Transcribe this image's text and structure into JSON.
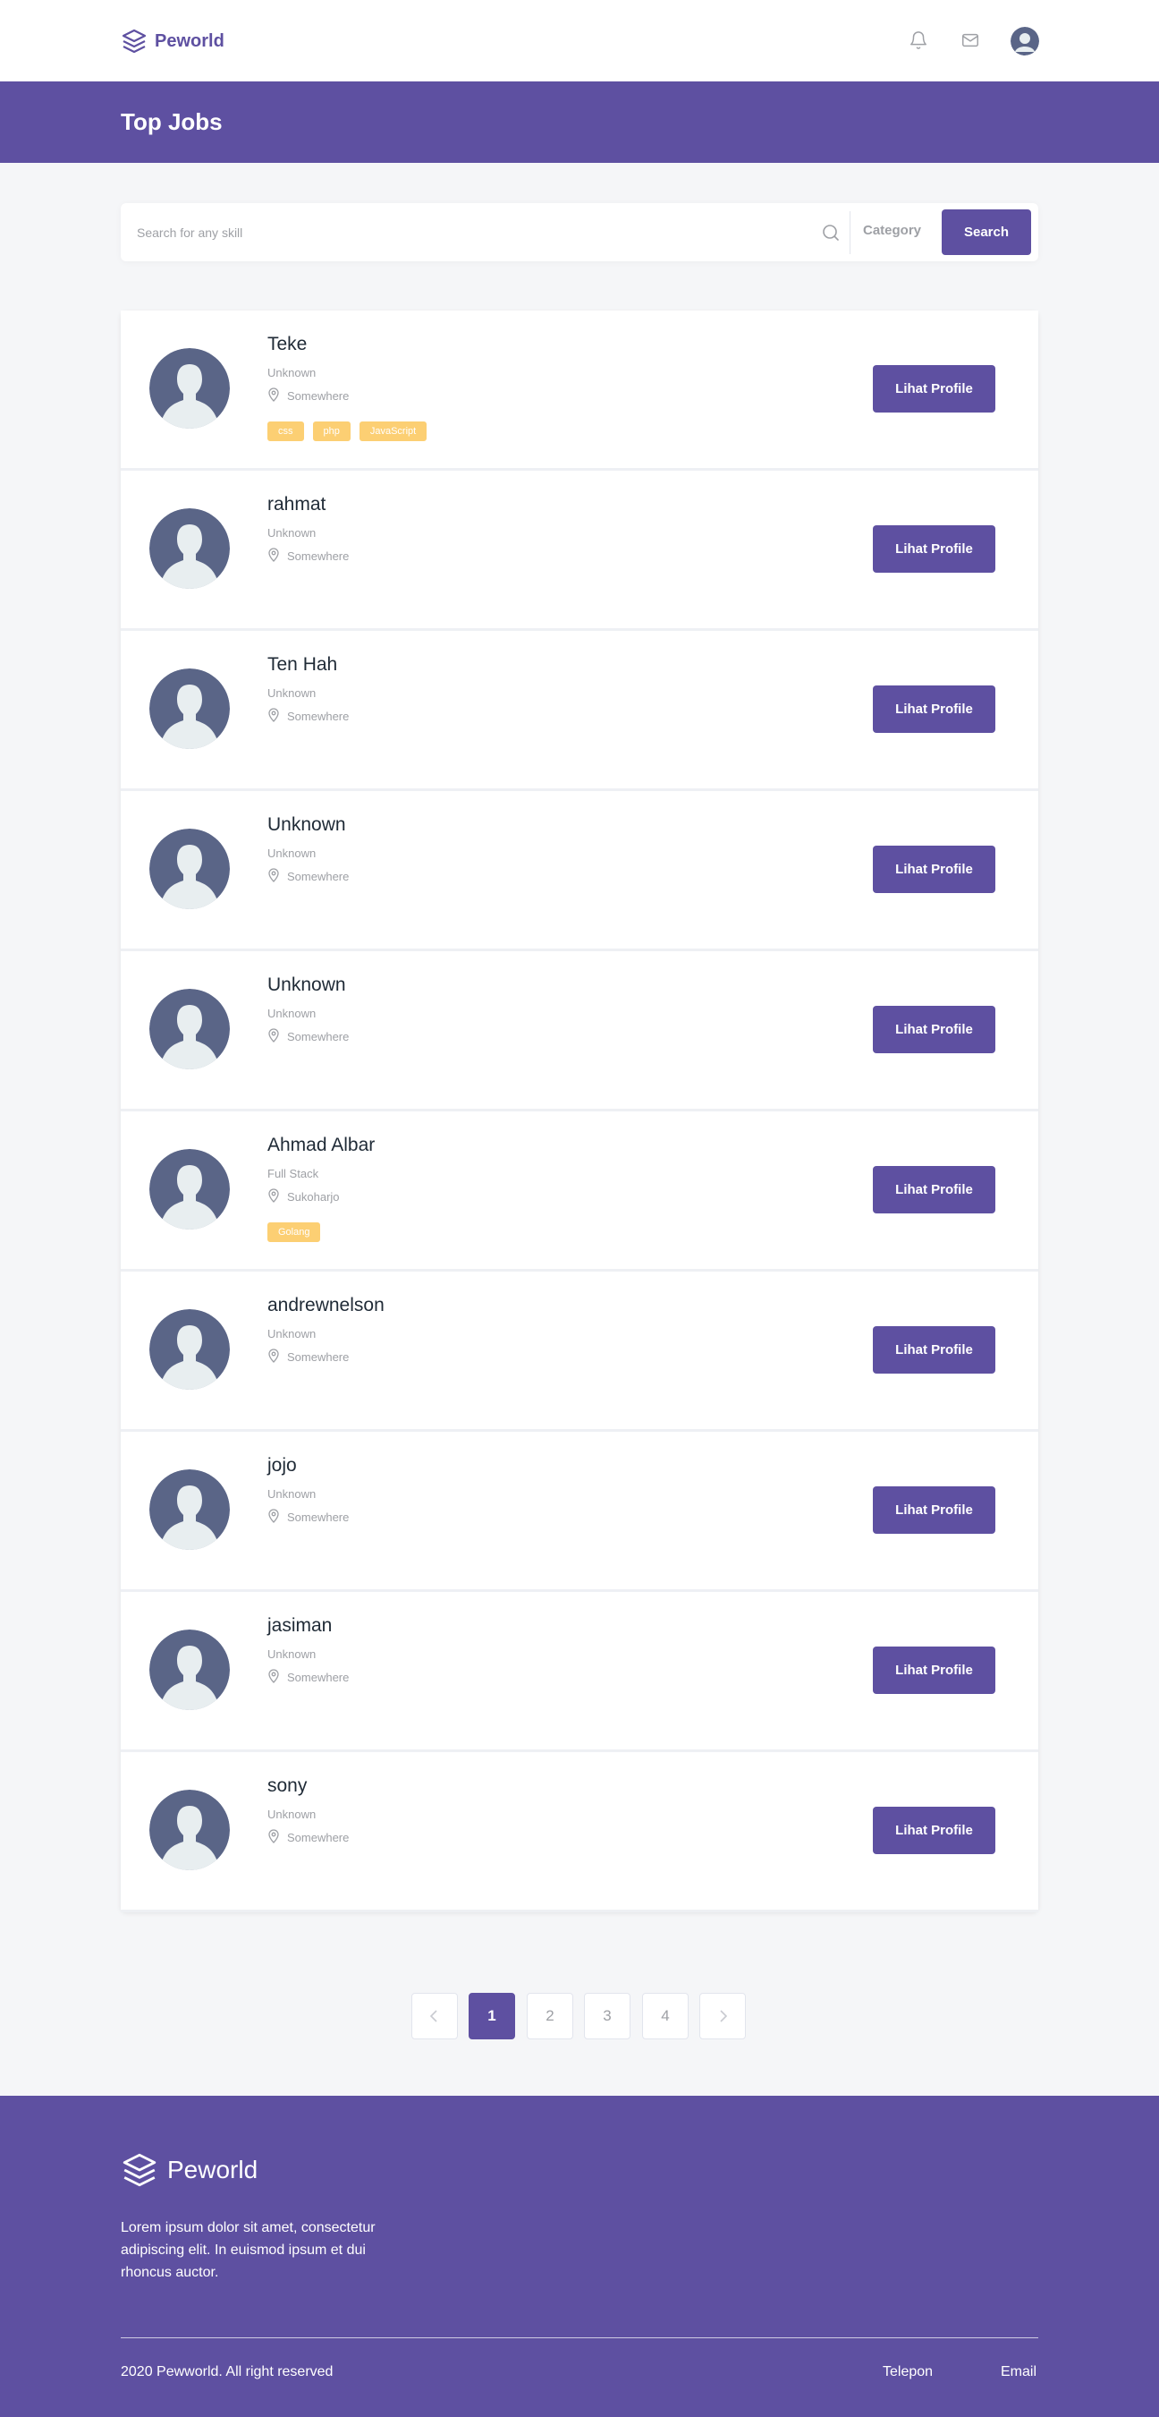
{
  "navbar": {
    "brand": "Peworld",
    "icons": [
      "bell-icon",
      "mail-icon",
      "avatar"
    ]
  },
  "hero": {
    "title": "Top Jobs"
  },
  "search": {
    "placeholder": "Search for any skill",
    "category_label": "Category",
    "button_label": "Search"
  },
  "profiles": [
    {
      "name": "Teke",
      "job": "Unknown",
      "location": "Somewhere",
      "skills": [
        "css",
        "php",
        "JavaScript"
      ],
      "button": "Lihat Profile"
    },
    {
      "name": "rahmat",
      "job": "Unknown",
      "location": "Somewhere",
      "skills": [],
      "button": "Lihat Profile"
    },
    {
      "name": "Ten Hah",
      "job": "Unknown",
      "location": "Somewhere",
      "skills": [],
      "button": "Lihat Profile"
    },
    {
      "name": "Unknown",
      "job": "Unknown",
      "location": "Somewhere",
      "skills": [],
      "button": "Lihat Profile"
    },
    {
      "name": "Unknown",
      "job": "Unknown",
      "location": "Somewhere",
      "skills": [],
      "button": "Lihat Profile"
    },
    {
      "name": "Ahmad Albar",
      "job": "Full Stack",
      "location": "Sukoharjo",
      "skills": [
        "Golang"
      ],
      "button": "Lihat Profile"
    },
    {
      "name": "andrewnelson",
      "job": "Unknown",
      "location": "Somewhere",
      "skills": [],
      "button": "Lihat Profile"
    },
    {
      "name": "jojo",
      "job": "Unknown",
      "location": "Somewhere",
      "skills": [],
      "button": "Lihat Profile"
    },
    {
      "name": "jasiman",
      "job": "Unknown",
      "location": "Somewhere",
      "skills": [],
      "button": "Lihat Profile"
    },
    {
      "name": "sony",
      "job": "Unknown",
      "location": "Somewhere",
      "skills": [],
      "button": "Lihat Profile"
    }
  ],
  "pagination": {
    "pages": [
      "1",
      "2",
      "3",
      "4"
    ],
    "current": "1"
  },
  "footer": {
    "brand": "Peworld",
    "description": "Lorem ipsum dolor sit amet, consectetur adipiscing elit. In euismod ipsum et dui rhoncus auctor.",
    "copyright": "2020 Pewworld. All right reserved",
    "links": [
      "Telepon",
      "Email"
    ]
  },
  "colors": {
    "primary": "#5E50A1",
    "skill_tag": "#FBB017",
    "background": "#F5F6F8"
  }
}
